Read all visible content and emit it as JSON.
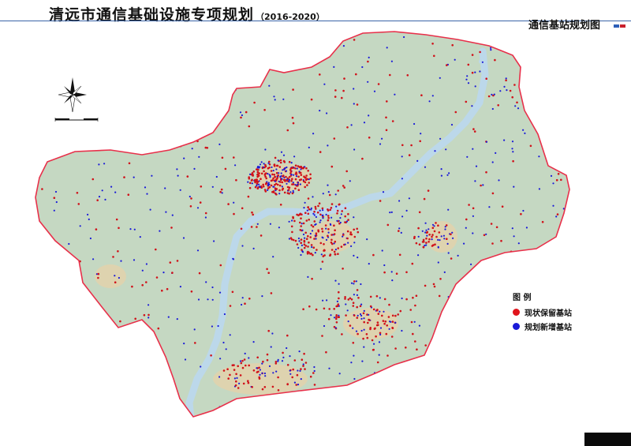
{
  "header": {
    "title": "清远市通信基础设施专项规划",
    "years": "（2016-2020）",
    "subtitle": "通信基站规划图",
    "flag_colors": [
      "#2d5fb8",
      "#c8202c"
    ]
  },
  "legend": {
    "title": "图  例",
    "items": [
      {
        "label": "现状保留基站",
        "color": "#e0141c"
      },
      {
        "label": "规划新增基站",
        "color": "#1a1ad8"
      }
    ]
  },
  "map": {
    "boundary_color": "#e8304a",
    "land_color": "#c5d8c2",
    "urban_color": "#f2cfa0",
    "river_color": "#bcd8ea",
    "existing_station_color": "#d0121a",
    "planned_station_color": "#1a1ad8",
    "north_arrow_icon": "compass-rose-icon"
  }
}
